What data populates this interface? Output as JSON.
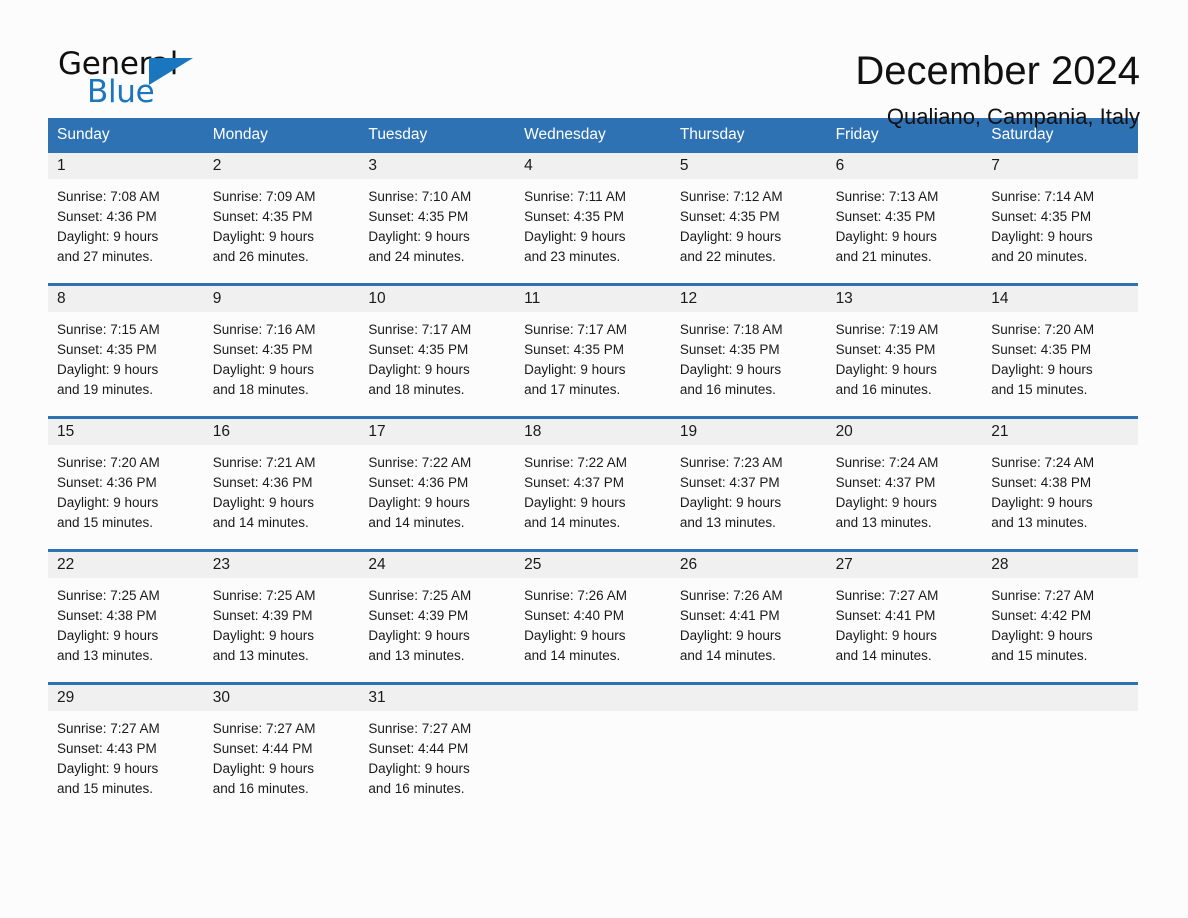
{
  "brand": {
    "name_primary": "General",
    "name_secondary": "Blue",
    "triangle_icon": "triangle-icon",
    "accent_color": "#1b76c0"
  },
  "header": {
    "title": "December 2024",
    "subtitle": "Qualiano, Campania, Italy"
  },
  "calendar": {
    "header_color": "#2f72b4",
    "daynum_band_color": "#f0f0f0",
    "weekdays": [
      "Sunday",
      "Monday",
      "Tuesday",
      "Wednesday",
      "Thursday",
      "Friday",
      "Saturday"
    ],
    "weeks": [
      [
        {
          "day": "1",
          "sunrise": "Sunrise: 7:08 AM",
          "sunset": "Sunset: 4:36 PM",
          "daylight1": "Daylight: 9 hours",
          "daylight2": "and 27 minutes."
        },
        {
          "day": "2",
          "sunrise": "Sunrise: 7:09 AM",
          "sunset": "Sunset: 4:35 PM",
          "daylight1": "Daylight: 9 hours",
          "daylight2": "and 26 minutes."
        },
        {
          "day": "3",
          "sunrise": "Sunrise: 7:10 AM",
          "sunset": "Sunset: 4:35 PM",
          "daylight1": "Daylight: 9 hours",
          "daylight2": "and 24 minutes."
        },
        {
          "day": "4",
          "sunrise": "Sunrise: 7:11 AM",
          "sunset": "Sunset: 4:35 PM",
          "daylight1": "Daylight: 9 hours",
          "daylight2": "and 23 minutes."
        },
        {
          "day": "5",
          "sunrise": "Sunrise: 7:12 AM",
          "sunset": "Sunset: 4:35 PM",
          "daylight1": "Daylight: 9 hours",
          "daylight2": "and 22 minutes."
        },
        {
          "day": "6",
          "sunrise": "Sunrise: 7:13 AM",
          "sunset": "Sunset: 4:35 PM",
          "daylight1": "Daylight: 9 hours",
          "daylight2": "and 21 minutes."
        },
        {
          "day": "7",
          "sunrise": "Sunrise: 7:14 AM",
          "sunset": "Sunset: 4:35 PM",
          "daylight1": "Daylight: 9 hours",
          "daylight2": "and 20 minutes."
        }
      ],
      [
        {
          "day": "8",
          "sunrise": "Sunrise: 7:15 AM",
          "sunset": "Sunset: 4:35 PM",
          "daylight1": "Daylight: 9 hours",
          "daylight2": "and 19 minutes."
        },
        {
          "day": "9",
          "sunrise": "Sunrise: 7:16 AM",
          "sunset": "Sunset: 4:35 PM",
          "daylight1": "Daylight: 9 hours",
          "daylight2": "and 18 minutes."
        },
        {
          "day": "10",
          "sunrise": "Sunrise: 7:17 AM",
          "sunset": "Sunset: 4:35 PM",
          "daylight1": "Daylight: 9 hours",
          "daylight2": "and 18 minutes."
        },
        {
          "day": "11",
          "sunrise": "Sunrise: 7:17 AM",
          "sunset": "Sunset: 4:35 PM",
          "daylight1": "Daylight: 9 hours",
          "daylight2": "and 17 minutes."
        },
        {
          "day": "12",
          "sunrise": "Sunrise: 7:18 AM",
          "sunset": "Sunset: 4:35 PM",
          "daylight1": "Daylight: 9 hours",
          "daylight2": "and 16 minutes."
        },
        {
          "day": "13",
          "sunrise": "Sunrise: 7:19 AM",
          "sunset": "Sunset: 4:35 PM",
          "daylight1": "Daylight: 9 hours",
          "daylight2": "and 16 minutes."
        },
        {
          "day": "14",
          "sunrise": "Sunrise: 7:20 AM",
          "sunset": "Sunset: 4:35 PM",
          "daylight1": "Daylight: 9 hours",
          "daylight2": "and 15 minutes."
        }
      ],
      [
        {
          "day": "15",
          "sunrise": "Sunrise: 7:20 AM",
          "sunset": "Sunset: 4:36 PM",
          "daylight1": "Daylight: 9 hours",
          "daylight2": "and 15 minutes."
        },
        {
          "day": "16",
          "sunrise": "Sunrise: 7:21 AM",
          "sunset": "Sunset: 4:36 PM",
          "daylight1": "Daylight: 9 hours",
          "daylight2": "and 14 minutes."
        },
        {
          "day": "17",
          "sunrise": "Sunrise: 7:22 AM",
          "sunset": "Sunset: 4:36 PM",
          "daylight1": "Daylight: 9 hours",
          "daylight2": "and 14 minutes."
        },
        {
          "day": "18",
          "sunrise": "Sunrise: 7:22 AM",
          "sunset": "Sunset: 4:37 PM",
          "daylight1": "Daylight: 9 hours",
          "daylight2": "and 14 minutes."
        },
        {
          "day": "19",
          "sunrise": "Sunrise: 7:23 AM",
          "sunset": "Sunset: 4:37 PM",
          "daylight1": "Daylight: 9 hours",
          "daylight2": "and 13 minutes."
        },
        {
          "day": "20",
          "sunrise": "Sunrise: 7:24 AM",
          "sunset": "Sunset: 4:37 PM",
          "daylight1": "Daylight: 9 hours",
          "daylight2": "and 13 minutes."
        },
        {
          "day": "21",
          "sunrise": "Sunrise: 7:24 AM",
          "sunset": "Sunset: 4:38 PM",
          "daylight1": "Daylight: 9 hours",
          "daylight2": "and 13 minutes."
        }
      ],
      [
        {
          "day": "22",
          "sunrise": "Sunrise: 7:25 AM",
          "sunset": "Sunset: 4:38 PM",
          "daylight1": "Daylight: 9 hours",
          "daylight2": "and 13 minutes."
        },
        {
          "day": "23",
          "sunrise": "Sunrise: 7:25 AM",
          "sunset": "Sunset: 4:39 PM",
          "daylight1": "Daylight: 9 hours",
          "daylight2": "and 13 minutes."
        },
        {
          "day": "24",
          "sunrise": "Sunrise: 7:25 AM",
          "sunset": "Sunset: 4:39 PM",
          "daylight1": "Daylight: 9 hours",
          "daylight2": "and 13 minutes."
        },
        {
          "day": "25",
          "sunrise": "Sunrise: 7:26 AM",
          "sunset": "Sunset: 4:40 PM",
          "daylight1": "Daylight: 9 hours",
          "daylight2": "and 14 minutes."
        },
        {
          "day": "26",
          "sunrise": "Sunrise: 7:26 AM",
          "sunset": "Sunset: 4:41 PM",
          "daylight1": "Daylight: 9 hours",
          "daylight2": "and 14 minutes."
        },
        {
          "day": "27",
          "sunrise": "Sunrise: 7:27 AM",
          "sunset": "Sunset: 4:41 PM",
          "daylight1": "Daylight: 9 hours",
          "daylight2": "and 14 minutes."
        },
        {
          "day": "28",
          "sunrise": "Sunrise: 7:27 AM",
          "sunset": "Sunset: 4:42 PM",
          "daylight1": "Daylight: 9 hours",
          "daylight2": "and 15 minutes."
        }
      ],
      [
        {
          "day": "29",
          "sunrise": "Sunrise: 7:27 AM",
          "sunset": "Sunset: 4:43 PM",
          "daylight1": "Daylight: 9 hours",
          "daylight2": "and 15 minutes."
        },
        {
          "day": "30",
          "sunrise": "Sunrise: 7:27 AM",
          "sunset": "Sunset: 4:44 PM",
          "daylight1": "Daylight: 9 hours",
          "daylight2": "and 16 minutes."
        },
        {
          "day": "31",
          "sunrise": "Sunrise: 7:27 AM",
          "sunset": "Sunset: 4:44 PM",
          "daylight1": "Daylight: 9 hours",
          "daylight2": "and 16 minutes."
        },
        {
          "day": "",
          "sunrise": "",
          "sunset": "",
          "daylight1": "",
          "daylight2": ""
        },
        {
          "day": "",
          "sunrise": "",
          "sunset": "",
          "daylight1": "",
          "daylight2": ""
        },
        {
          "day": "",
          "sunrise": "",
          "sunset": "",
          "daylight1": "",
          "daylight2": ""
        },
        {
          "day": "",
          "sunrise": "",
          "sunset": "",
          "daylight1": "",
          "daylight2": ""
        }
      ]
    ]
  }
}
